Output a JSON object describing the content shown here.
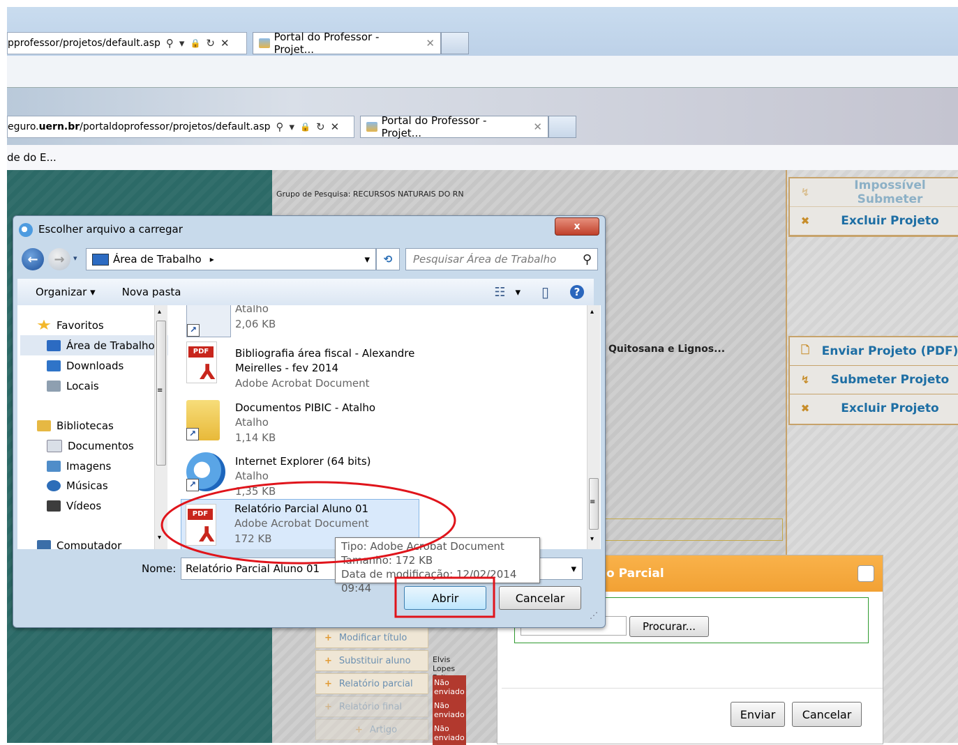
{
  "browser": {
    "back_address": "pprofessor/projetos/default.asp",
    "back_tab_title": "Portal do Professor - Projet...",
    "front_address_prefix": "eguro.",
    "front_address_host": "uern.br",
    "front_address_path": "/portaldoprofessor/projetos/default.asp",
    "front_tab_title": "Portal do Professor - Projet...",
    "favorites_item": "de do E...",
    "addr_search_icon": "⚲",
    "addr_dropdown_icon": "▾",
    "addr_lock_icon": "🔒",
    "addr_refresh_icon": "↻",
    "addr_stop_icon": "✕",
    "tab_close_icon": "✕"
  },
  "page": {
    "grupo_pesquisa": "Grupo de Pesquisa: RECURSOS NATURAIS DO RN",
    "project_title_fragment": "Quitosana e Lignos...",
    "actions_top": [
      {
        "icon": "↯",
        "label": "Impossível Submeter"
      },
      {
        "icon": "✖",
        "label": "Excluir Projeto"
      }
    ],
    "actions_mid": [
      {
        "icon": "🗋",
        "label": "Enviar Projeto (PDF)"
      },
      {
        "icon": "↯",
        "label": "Submeter Projeto"
      },
      {
        "icon": "✖",
        "label": "Excluir Projeto"
      }
    ],
    "student_actions": [
      {
        "label": "Modificar título",
        "status": ""
      },
      {
        "label": "Substituir aluno",
        "status": "Elvis Lopes Brit"
      },
      {
        "label": "Relatório parcial",
        "status": "Não enviado"
      },
      {
        "label": "Relatório final",
        "status": "Não enviado"
      },
      {
        "label": "Artigo",
        "status": "Não enviado"
      }
    ]
  },
  "upload_modal": {
    "title": "o Parcial",
    "browse_button": "Procurar...",
    "submit_button": "Enviar",
    "cancel_button": "Cancelar"
  },
  "dialog": {
    "title": "Escolher arquivo a carregar",
    "close_label": "x",
    "back_icon": "←",
    "forward_icon": "→",
    "location": "Área de Trabalho",
    "location_arrow": "▸",
    "dropdown_icon": "▾",
    "refresh_icon": "⟲",
    "search_placeholder": "Pesquisar Área de Trabalho",
    "search_icon": "⚲",
    "organize_label": "Organizar",
    "organize_arrow": "▾",
    "new_folder_label": "Nova pasta",
    "views_icon": "☷",
    "views_arrow": "▾",
    "preview_icon": "▯",
    "help_icon": "?",
    "nav_items": [
      {
        "label": "Favoritos",
        "icon": "star-icon",
        "color": "#f3b72b"
      },
      {
        "label": "Área de Trabalho",
        "icon": "desktop-icon",
        "color": "#2c6bc2"
      },
      {
        "label": "Downloads",
        "icon": "downloads-icon",
        "color": "#2f74c8"
      },
      {
        "label": "Locais",
        "icon": "places-icon",
        "color": "#8e9fb0"
      },
      {
        "label": "Bibliotecas",
        "icon": "libraries-icon",
        "color": "#e6b843"
      },
      {
        "label": "Documentos",
        "icon": "documents-icon",
        "color": "#d9dfe7"
      },
      {
        "label": "Imagens",
        "icon": "images-icon",
        "color": "#4f8dc9"
      },
      {
        "label": "Músicas",
        "icon": "music-icon",
        "color": "#2d6db8"
      },
      {
        "label": "Vídeos",
        "icon": "videos-icon",
        "color": "#3d3d3d"
      },
      {
        "label": "Computador",
        "icon": "computer-icon",
        "color": "#3b6ea8"
      }
    ],
    "files": [
      {
        "title": "Atalho",
        "line2": "2,06 KB",
        "line3": "",
        "icon": "document-shortcut-icon"
      },
      {
        "title": "Bibliografia área fiscal - Alexandre",
        "line2": "Meirelles - fev 2014",
        "line3": "Adobe Acrobat Document",
        "icon": "pdf-icon"
      },
      {
        "title": "Documentos PIBIC - Atalho",
        "line2": "Atalho",
        "line3": "1,14 KB",
        "icon": "folder-shortcut-icon"
      },
      {
        "title": "Internet Explorer (64 bits)",
        "line2": "Atalho",
        "line3": "1,35 KB",
        "icon": "internet-explorer-icon"
      },
      {
        "title": "Relatório Parcial Aluno 01",
        "line2": "Adobe Acrobat Document",
        "line3": "172 KB",
        "icon": "pdf-icon"
      }
    ],
    "pdf_label": "PDF",
    "pdf_symbol": "⅄",
    "shortcut_symbol": "↗",
    "scroll_up": "▴",
    "scroll_down": "▾",
    "thumb_grip": "≡",
    "tooltip": {
      "line1": "Tipo: Adobe Acrobat Document",
      "line2": "Tamanho: 172 KB",
      "line3": "Data de modificação: 12/02/2014 09:44"
    },
    "name_label": "Nome:",
    "name_value": "Relatório Parcial Aluno 01",
    "name_dropdown": "▾",
    "open_button": "Abrir",
    "cancel_button": "Cancelar",
    "resize_grip": "⋰"
  },
  "annotations": {
    "ellipse_color": "#e0141b",
    "box_color": "#e0141b"
  }
}
